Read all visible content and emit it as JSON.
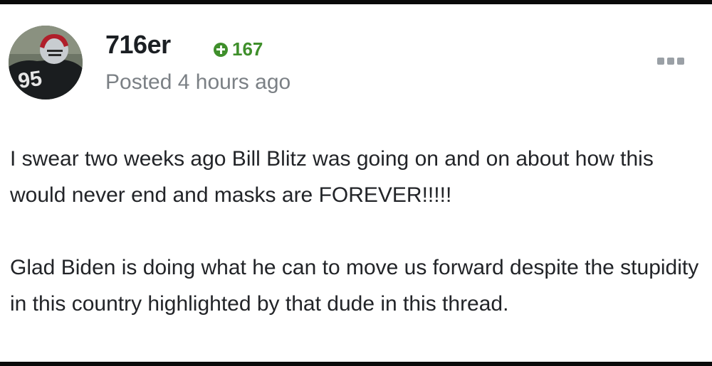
{
  "post": {
    "author": {
      "username": "716er",
      "reputation": "167",
      "avatar_icon": "football-player-avatar"
    },
    "timestamp": "Posted 4 hours ago",
    "menu_icon": "more-options-icon",
    "paragraphs": [
      "I swear two weeks ago Bill Blitz was going on and on about how this would never end and masks are FOREVER!!!!!",
      "Glad Biden is doing what he can to move us forward despite the stupidity in this country highlighted by that dude in this thread."
    ]
  },
  "colors": {
    "reputation": "#3f8f2b",
    "username": "#1b1f23",
    "muted": "#7b8085",
    "body_text": "#222428"
  }
}
